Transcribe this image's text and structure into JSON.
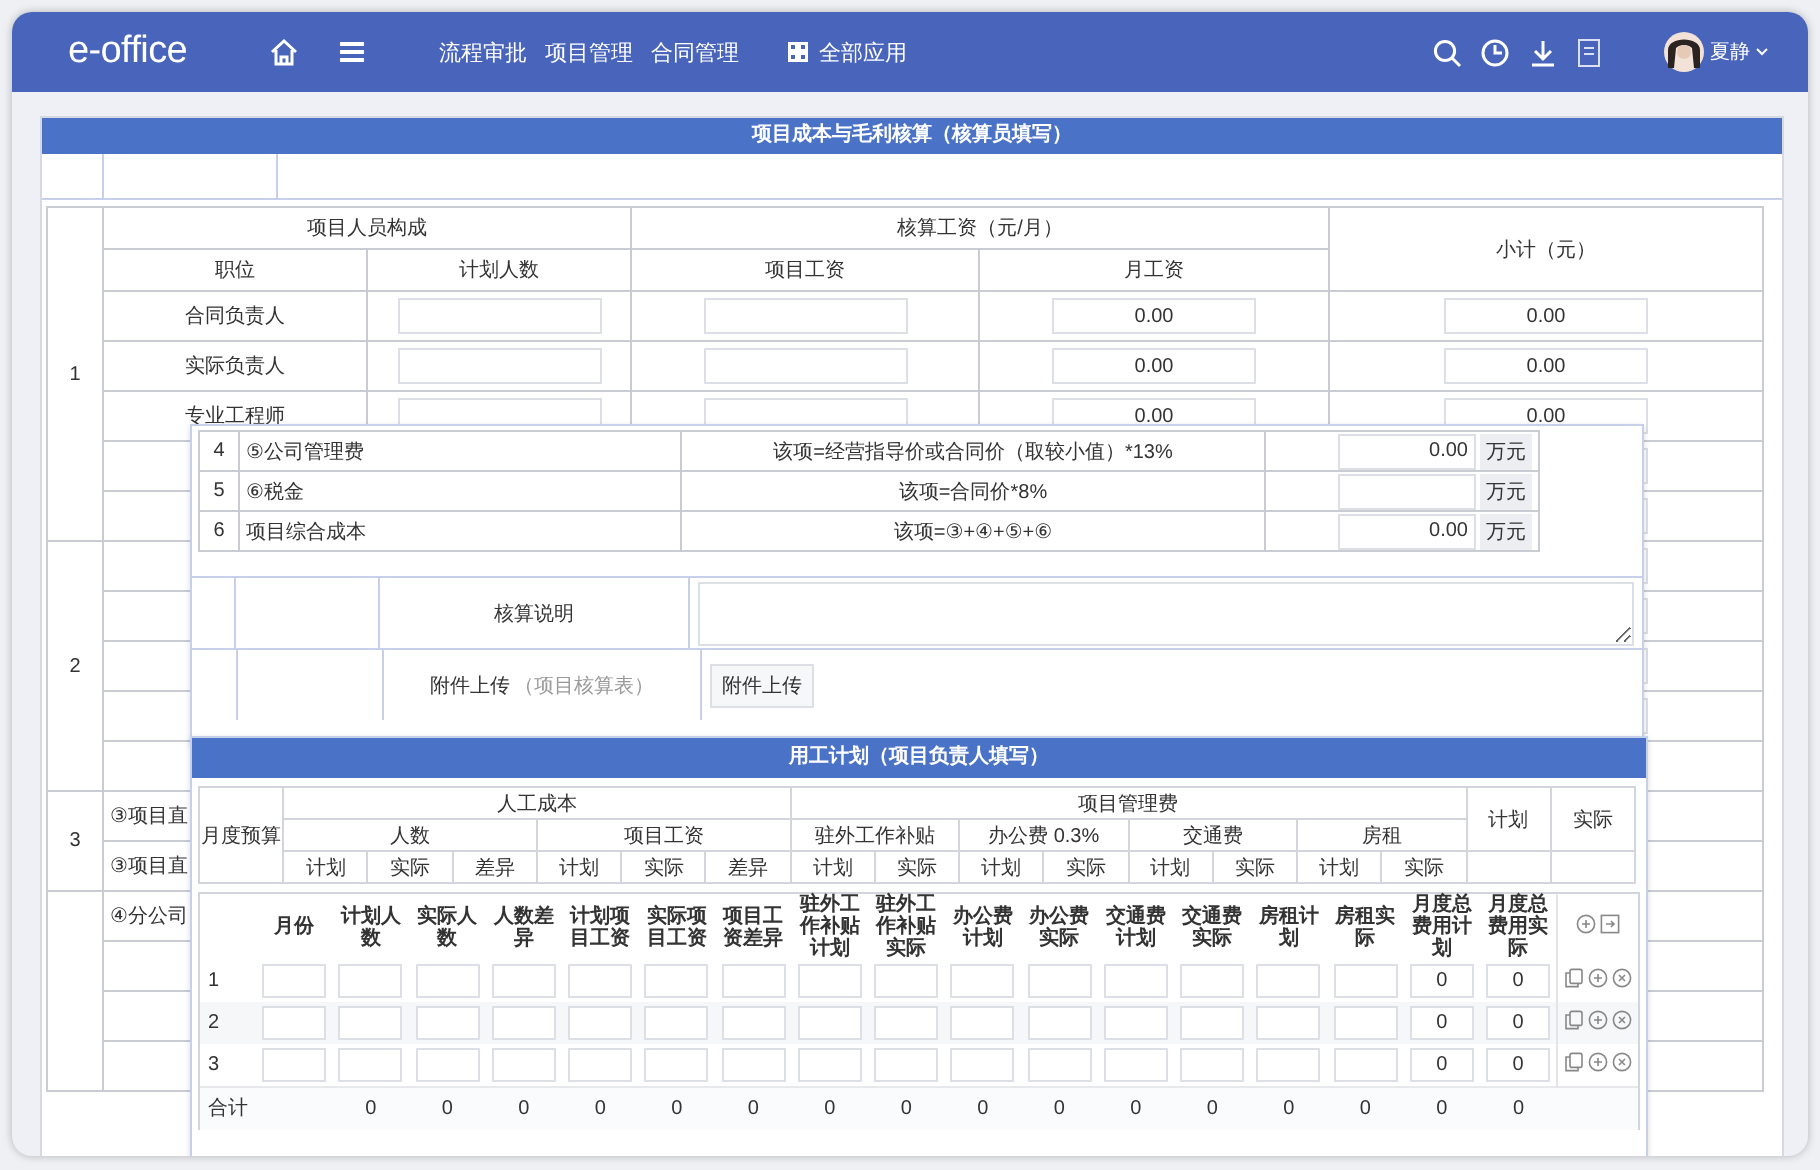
{
  "header": {
    "logo": "e-office",
    "nav": [
      {
        "label": "流程审批"
      },
      {
        "label": "项目管理"
      },
      {
        "label": "合同管理"
      }
    ],
    "apps_label": "全部应用",
    "user_name": "夏静"
  },
  "cost_sheet": {
    "title": "项目成本与毛利核算（核算员填写）",
    "group_headers": [
      "项目人员构成",
      "核算工资（元/月）",
      "小计（元）"
    ],
    "columns": [
      "职位",
      "计划人数",
      "项目工资",
      "月工资"
    ],
    "sections": [
      {
        "number": "1",
        "rows": [
          {
            "kind": "staff",
            "position": "合同负责人",
            "monthly": "0.00",
            "subtotal": "0.00"
          },
          {
            "kind": "staff",
            "position": "实际负责人",
            "monthly": "0.00",
            "subtotal": "0.00"
          },
          {
            "kind": "staff",
            "position": "专业工程师",
            "monthly": "0.00",
            "subtotal": "0.00"
          },
          {
            "kind": "input"
          },
          {
            "kind": "input"
          }
        ]
      },
      {
        "number": "2",
        "rows": [
          {
            "kind": "input"
          },
          {
            "kind": "input"
          },
          {
            "kind": "input"
          },
          {
            "kind": "input"
          },
          {
            "kind": "blank"
          }
        ]
      },
      {
        "number": "3",
        "rows": [
          {
            "kind": "item",
            "label": "③项目直"
          },
          {
            "kind": "item",
            "label": "③项目直"
          }
        ]
      },
      {
        "rows": [
          {
            "kind": "item",
            "label": "④分公司"
          },
          {
            "kind": "blank"
          },
          {
            "kind": "input"
          },
          {
            "kind": "input"
          }
        ]
      }
    ]
  },
  "cost_summary": {
    "rows": [
      {
        "number": "4",
        "item": "⑤公司管理费",
        "formula": "该项=经营指导价或合同价（取较小值）*13%",
        "value": "0.00",
        "unit": "万元"
      },
      {
        "number": "5",
        "item": "⑥税金",
        "formula": "该项=合同价*8%",
        "unit": "万元"
      },
      {
        "number": "6",
        "item": "项目综合成本",
        "formula": "该项=③+④+⑤+⑥",
        "value": "0.00",
        "unit": "万元"
      }
    ],
    "note_label": "核算说明",
    "attach_label": "附件上传",
    "attach_hint": "（项目核算表）",
    "attach_button": "附件上传"
  },
  "labor_plan": {
    "title": "用工计划（项目负责人填写）",
    "budget_label": "月度预算",
    "groups": [
      {
        "label": "人工成本",
        "subgroups": [
          {
            "label": "人数",
            "columns": [
              "计划",
              "实际",
              "差异"
            ]
          },
          {
            "label": "项目工资",
            "columns": [
              "计划",
              "实际",
              "差异"
            ]
          }
        ]
      },
      {
        "label": "项目管理费",
        "subgroups": [
          {
            "label": "驻外工作补贴",
            "columns": [
              "计划",
              "实际"
            ]
          },
          {
            "label": "办公费 0.3%",
            "columns": [
              "计划",
              "实际"
            ]
          },
          {
            "label": "交通费",
            "columns": [
              "计划",
              "实际"
            ]
          },
          {
            "label": "房租",
            "columns": [
              "计划",
              "实际"
            ]
          }
        ]
      }
    ],
    "extra_columns": [
      "计划",
      "实际"
    ],
    "detail_columns": [
      "月份",
      "计划人数",
      "实际人数",
      "人数差异",
      "计划项目工资",
      "实际项目工资",
      "项目工资差异",
      "驻外工作补贴计划",
      "驻外工作补贴实际",
      "办公费计划",
      "办公费实际",
      "交通费计划",
      "交通费实际",
      "房租计划",
      "房租实际",
      "月度总费用计划",
      "月度总费用实际"
    ],
    "rows": [
      {
        "number": "1",
        "plan_total": "0",
        "actual_total": "0"
      },
      {
        "number": "2",
        "plan_total": "0",
        "actual_total": "0"
      },
      {
        "number": "3",
        "plan_total": "0",
        "actual_total": "0"
      }
    ],
    "total": {
      "label": "合计",
      "values": [
        "0",
        "0",
        "0",
        "0",
        "0",
        "0",
        "0",
        "0",
        "0",
        "0",
        "0",
        "0",
        "0",
        "0",
        "0",
        "0"
      ]
    }
  }
}
